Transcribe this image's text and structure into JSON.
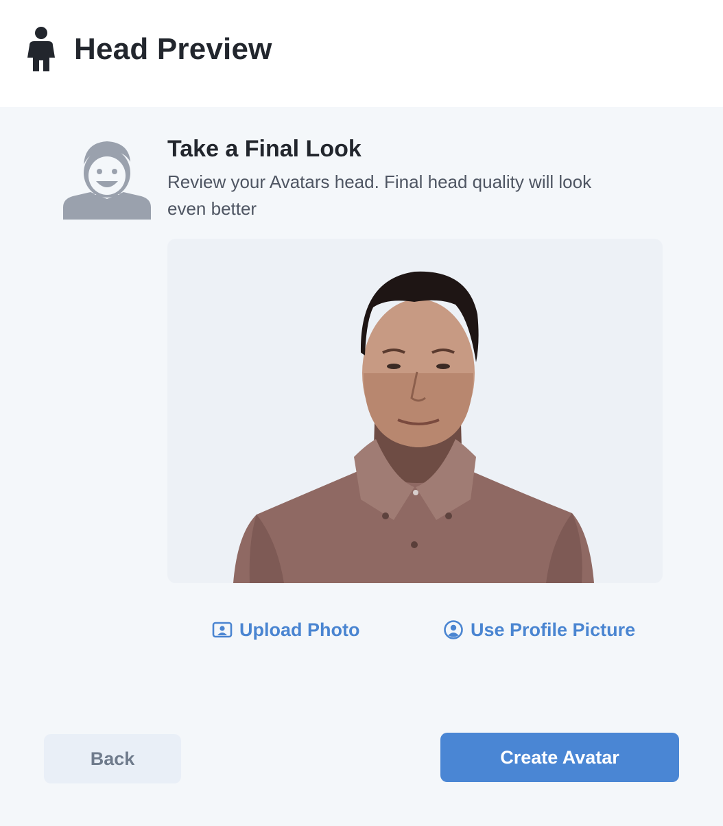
{
  "header": {
    "title": "Head Preview",
    "icon": "person-icon"
  },
  "intro": {
    "icon": "avatar-placeholder-icon",
    "title": "Take a Final Look",
    "description": "Review your Avatars head. Final head quality will look even better"
  },
  "preview": {
    "image": "avatar-head-render"
  },
  "actions": {
    "upload": {
      "label": "Upload Photo",
      "icon": "image-icon"
    },
    "profile": {
      "label": "Use Profile Picture",
      "icon": "user-circle-icon"
    }
  },
  "footer": {
    "back_label": "Back",
    "create_label": "Create Avatar"
  },
  "colors": {
    "accent": "#4a86d4",
    "link": "#4a85d1",
    "back_bg": "#e9eff7",
    "panel_bg": "#f4f7fa"
  }
}
